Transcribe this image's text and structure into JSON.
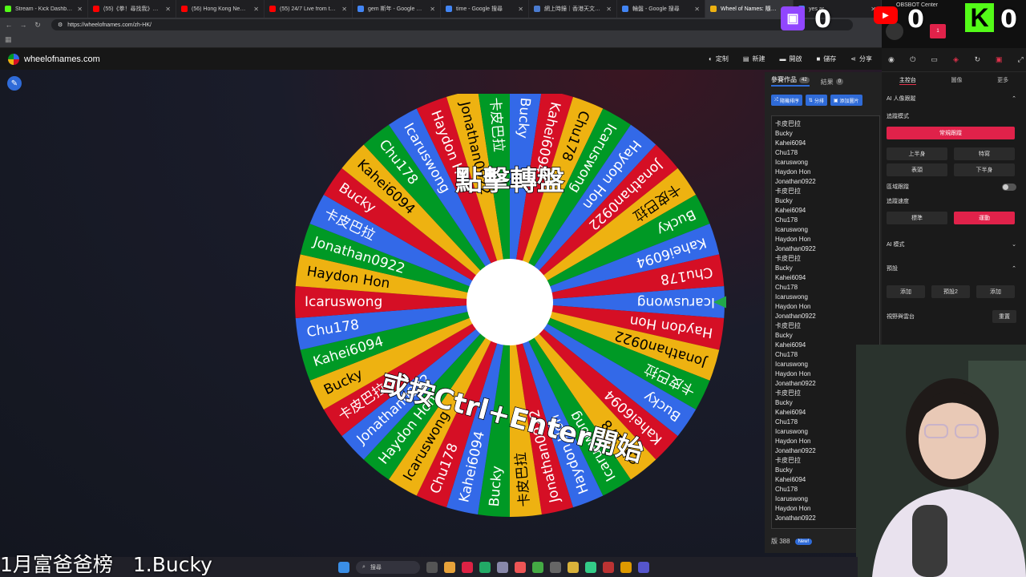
{
  "browser": {
    "tabs": [
      {
        "title": "Stream - Kick Dashboard",
        "color": "#53fc18"
      },
      {
        "title": "(55)《拳！尋找我》2026年...",
        "color": "#ff0000"
      },
      {
        "title": "(56) Hong Kong New Year C",
        "color": "#ff0000"
      },
      {
        "title": "(55) 24/7 Live from the Inter",
        "color": "#ff0000"
      },
      {
        "title": "gem 斯年 - Google 搜尋",
        "color": "#4285f4"
      },
      {
        "title": "time - Google 搜尋",
        "color": "#4285f4"
      },
      {
        "title": "網上時鐘｜香港天文台(HKO)",
        "color": "#4a7bd0"
      },
      {
        "title": "輪盤 - Google 搜尋",
        "color": "#4285f4"
      },
      {
        "title": "Wheel of Names: 隨機選...",
        "color": "#eeb211",
        "active": true
      },
      {
        "title": "yes ar",
        "color": "#4285f4"
      }
    ],
    "url": "https://wheelofnames.com/zh-HK/"
  },
  "site": {
    "name": "wheelofnames.com",
    "menu": [
      {
        "icon": "palette-icon",
        "glyph": "◐",
        "label": "定制"
      },
      {
        "icon": "new-file-icon",
        "glyph": "▤",
        "label": "新建"
      },
      {
        "icon": "folder-icon",
        "glyph": "▬",
        "label": "開啟"
      },
      {
        "icon": "save-icon",
        "glyph": "■",
        "label": "儲存"
      },
      {
        "icon": "share-icon",
        "glyph": "⋖",
        "label": "分享"
      }
    ]
  },
  "wheel": {
    "colors": [
      "#3369e8",
      "#d50f25",
      "#eeb211",
      "#009925"
    ],
    "slice_names": [
      "Icaruswong",
      "Haydon Hon",
      "Jonathan0922",
      "卡皮巴拉",
      "Bucky",
      "Kahei6094",
      "Chu178",
      "Icaruswong",
      "Haydon Hon",
      "Jonathan0922",
      "卡皮巴拉",
      "Bucky",
      "Kahei6094",
      "Chu178",
      "Icaruswong",
      "Haydon Hon",
      "Jonathan0922",
      "卡皮巴拉",
      "Bucky",
      "Kahei6094",
      "Chu178",
      "Icaruswong",
      "Haydon Hon",
      "Jonathan0922",
      "卡皮巴拉",
      "Bucky",
      "Kahei6094",
      "Chu178",
      "Icaruswong",
      "Haydon Hon",
      "Jonathan0922",
      "卡皮巴拉",
      "Bucky",
      "Kahei6094",
      "Chu178",
      "Icaruswong",
      "Haydon Hon",
      "Jonathan0922",
      "卡皮巴拉",
      "Bucky",
      "Kahei6094",
      "Chu178"
    ],
    "prompt_top": "點擊轉盤",
    "prompt_bottom": "或按Ctrl+Enter開始"
  },
  "sidebar": {
    "tab_entries": "參賽作品",
    "tab_entries_count": "42",
    "tab_results": "結果",
    "tab_results_count": "0",
    "shuffle": "隨機排序",
    "sort": "分排",
    "add_image": "添加圖片",
    "entries": [
      "卡皮巴拉",
      "Bucky",
      "Kahei6094",
      "Chu178",
      "Icaruswong",
      "Haydon Hon",
      "Jonathan0922",
      "卡皮巴拉",
      "Bucky",
      "Kahei6094",
      "Chu178",
      "Icaruswong",
      "Haydon Hon",
      "Jonathan0922",
      "卡皮巴拉",
      "Bucky",
      "Kahei6094",
      "Chu178",
      "Icaruswong",
      "Haydon Hon",
      "Jonathan0922",
      "卡皮巴拉",
      "Bucky",
      "Kahei6094",
      "Chu178",
      "Icaruswong",
      "Haydon Hon",
      "Jonathan0922",
      "卡皮巴拉",
      "Bucky",
      "Kahei6094",
      "Chu178",
      "Icaruswong",
      "Haydon Hon",
      "Jonathan0922",
      "卡皮巴拉",
      "Bucky",
      "Kahei6094",
      "Chu178",
      "Icaruswong",
      "Haydon Hon",
      "Jonathan0922"
    ],
    "footer_text": "版 388",
    "new_badge": "New!"
  },
  "obsbot": {
    "title": "OBSBOT Center",
    "tabs": [
      "主控台",
      "圖像",
      "更多"
    ],
    "ai_tracking": "AI 人像跟蹤",
    "tracking_mode": "追蹤模式",
    "normal_tracking": "常規跟蹤",
    "upper_body": "上半身",
    "close_up": "特寫",
    "headshot": "表頭",
    "lower_body": "下半身",
    "region_tracking": "區域跟蹤",
    "tracking_speed": "追蹤速度",
    "standard": "標準",
    "dynamic": "運動",
    "ai_mode": "AI 模式",
    "presets": "預設",
    "add": "添加",
    "preset2": "預設2",
    "gimbal": "視野與雲台",
    "reset": "重置",
    "badge": "1"
  },
  "scores": {
    "twitch": "0",
    "youtube": "0",
    "kick": "0"
  },
  "taskbar": {
    "ticker": "1月富爸爸榜　1.Bucky",
    "search": "搜尋"
  }
}
